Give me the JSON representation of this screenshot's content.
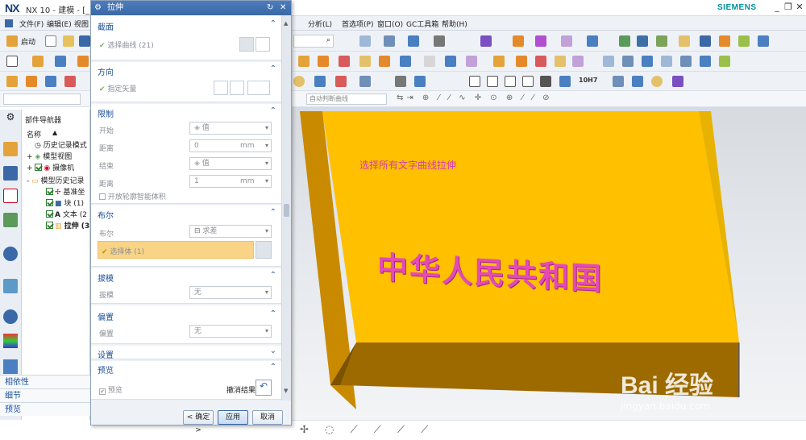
{
  "titlebar": {
    "logo": "NX",
    "title": "NX 10 - 建模 - [_m",
    "brand": "SIEMENS"
  },
  "menubar": {
    "items": [
      "文件(F)",
      "编辑(E)",
      "视图",
      "分析(L)",
      "首选项(P)",
      "窗口(O)",
      "GC工具箱",
      "帮助(H)"
    ]
  },
  "toolbar": {
    "start_label": "启动",
    "snap_placeholder": "自动判断曲线",
    "hole_label": "10H7"
  },
  "viewport": {
    "annotation": "选择所有文字曲线拉伸",
    "embossed_text": "中华人民共和国",
    "top_face_color": "#FFC000",
    "side_face_color": "#C98A00",
    "watermark_brand": "Bai 经验",
    "watermark_url": "jingyan.baidu.com"
  },
  "navigator": {
    "title": "部件导航器",
    "column": "名称",
    "rows": [
      {
        "label": "历史记录模式",
        "indent": 1
      },
      {
        "label": "模型视图",
        "indent": 1
      },
      {
        "label": "摄像机",
        "indent": 1
      },
      {
        "label": "模型历史记录",
        "indent": 1
      },
      {
        "label": "基准坐",
        "indent": 2
      },
      {
        "label": "块 (1)",
        "indent": 2
      },
      {
        "label": "文本 (2",
        "indent": 2
      },
      {
        "label": "拉伸 (3",
        "indent": 2
      }
    ],
    "accordions": [
      "相依性",
      "细节",
      "预览"
    ]
  },
  "dialog": {
    "title": "拉伸",
    "section_curve": {
      "title": "截面",
      "select_label": "选择曲线 (21)"
    },
    "section_direction": {
      "title": "方向",
      "vector_label": "指定矢量"
    },
    "section_limits": {
      "title": "限制",
      "start_label": "开始",
      "start_value": "值",
      "dist1_label": "距离",
      "dist1_value": "0",
      "dist1_unit": "mm",
      "end_label": "结束",
      "end_value": "值",
      "dist2_label": "距离",
      "dist2_value": "1",
      "dist2_unit": "mm",
      "open_profile_label": "开放轮廓智能体积"
    },
    "section_boolean": {
      "title": "布尔",
      "bool_label": "布尔",
      "bool_value": "求差",
      "select_body_label": "选择体 (1)"
    },
    "section_draft": {
      "title": "拔模",
      "draft_label": "拔模",
      "draft_value": "无"
    },
    "section_offset": {
      "title": "偏置",
      "offset_label": "偏置",
      "offset_value": "无"
    },
    "section_settings": {
      "title": "设置"
    },
    "section_preview": {
      "title": "预览",
      "preview_label": "预览",
      "show_result_label": "撤消结果"
    },
    "buttons": {
      "ok": "< 确定 >",
      "apply": "应用",
      "cancel": "取消"
    }
  }
}
